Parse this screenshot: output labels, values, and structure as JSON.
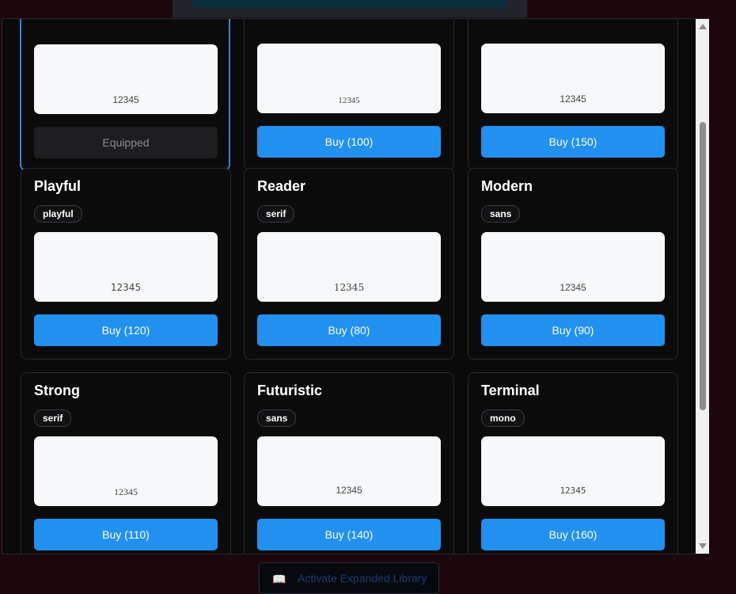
{
  "cards": [
    {
      "title": "",
      "tag": "",
      "sample": "12345",
      "button": "Equipped"
    },
    {
      "title": "",
      "tag": "",
      "sample": "12345",
      "button": "Buy (100)"
    },
    {
      "title": "",
      "tag": "",
      "sample": "12345",
      "button": "Buy (150)"
    },
    {
      "title": "Playful",
      "tag": "playful",
      "sample": "12345",
      "button": "Buy (120)"
    },
    {
      "title": "Reader",
      "tag": "serif",
      "sample": "12345",
      "button": "Buy (80)"
    },
    {
      "title": "Modern",
      "tag": "sans",
      "sample": "12345",
      "button": "Buy (90)"
    },
    {
      "title": "Strong",
      "tag": "serif",
      "sample": "12345",
      "button": "Buy (110)"
    },
    {
      "title": "Futuristic",
      "tag": "sans",
      "sample": "12345",
      "button": "Buy (140)"
    },
    {
      "title": "Terminal",
      "tag": "mono",
      "sample": "12345",
      "button": "Buy (160)"
    }
  ],
  "footer": {
    "activate_label": "Activate Expanded Library",
    "icon": "book-icon"
  },
  "colors": {
    "accent": "#2290ef",
    "equipped_border": "#3e7fd8",
    "background": "#1c070d"
  }
}
